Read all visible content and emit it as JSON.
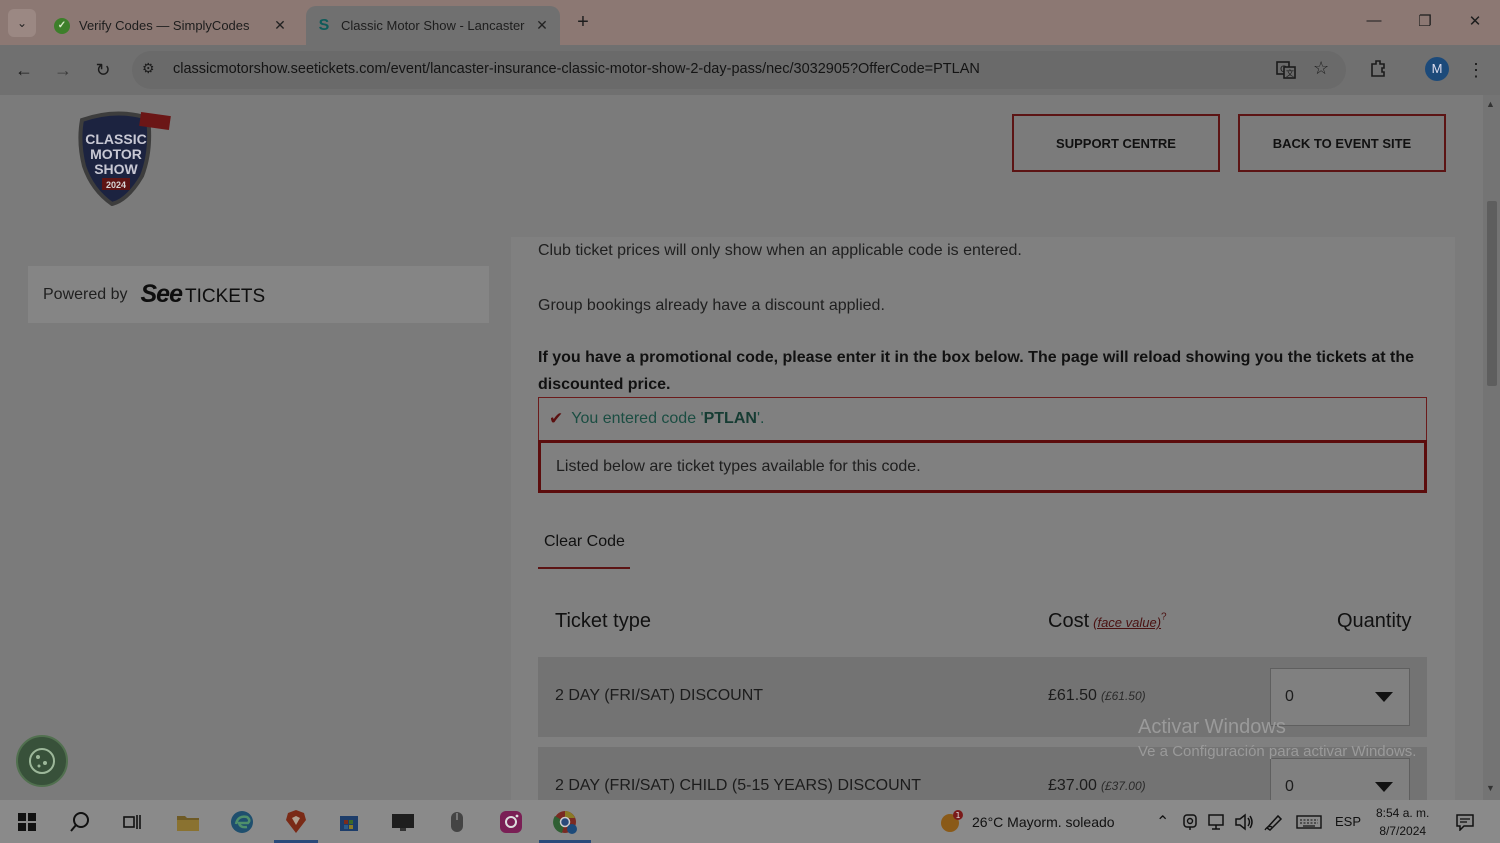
{
  "browser": {
    "tabs": [
      {
        "title": "Verify Codes — SimplyCodes",
        "active": false
      },
      {
        "title": "Classic Motor Show - Lancaster",
        "active": true
      }
    ],
    "url": "classicmotorshow.seetickets.com/event/lancaster-insurance-classic-motor-show-2-day-pass/nec/3032905?OfferCode=PTLAN",
    "profile_initial": "M"
  },
  "header": {
    "logo_lines": [
      "CLASSIC",
      "MOTOR",
      "SHOW",
      "2024"
    ],
    "support_button": "SUPPORT CENTRE",
    "back_button": "BACK TO EVENT SITE"
  },
  "sidebar": {
    "powered_by": "Powered by",
    "brand_see": "See",
    "brand_tickets": "TICKETS"
  },
  "main": {
    "club_note": "Club ticket prices will only show when an applicable code is entered.",
    "group_note": "Group bookings already have a discount applied.",
    "promo_instruction": "If you have a promotional code, please enter it in the box below. The page will reload showing you the tickets at the discounted price.",
    "code_prefix": "You entered code '",
    "code_value": "PTLAN",
    "code_suffix": "'.",
    "listed_message": "Listed below are ticket types available for this code.",
    "clear_code": "Clear Code",
    "table": {
      "col_ticket_type": "Ticket type",
      "col_cost": "Cost",
      "col_face_value": "(face value)",
      "col_face_value_sup": "?",
      "col_quantity": "Quantity",
      "rows": [
        {
          "name": "2 DAY (FRI/SAT) DISCOUNT",
          "price": "£61.50",
          "face_value": "(£61.50)",
          "quantity": "0"
        },
        {
          "name": "2 DAY (FRI/SAT) CHILD (5-15 YEARS) DISCOUNT",
          "price": "£37.00",
          "face_value": "(£37.00)",
          "quantity": "0"
        }
      ]
    }
  },
  "watermark": {
    "line1": "Activar Windows",
    "line2": "Ve a Configuración para activar Windows."
  },
  "taskbar": {
    "weather": "26°C  Mayorm. soleado",
    "language": "ESP",
    "time": "8:54 a. m.",
    "date": "8/7/2024"
  }
}
